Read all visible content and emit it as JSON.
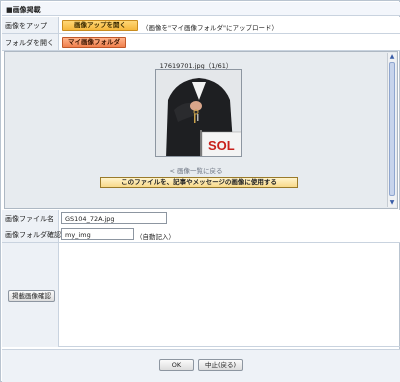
{
  "section_title": "■画像掲載",
  "upload": {
    "label": "画像をアップ",
    "button": "画像アップを開く",
    "hint": "（画像を\"マイ画像フォルダ\"にアップロード）"
  },
  "folder": {
    "label": "フォルダを開く",
    "button": "マイ画像フォルダ"
  },
  "viewer": {
    "filename": "17619701.jpg（1/61）",
    "back_link": "< 画像一覧に戻る",
    "use_button": "このファイルを、記事やメッセージの画像に使用する",
    "photo_text": "SOL"
  },
  "file_name": {
    "label": "画像ファイル名",
    "value": "GS104_72A.jpg"
  },
  "folder_path": {
    "label": "画像フォルダ確認",
    "value": "my_img",
    "note": "（自動記入）"
  },
  "confirm_button": "掲載画像確認",
  "footer": {
    "ok": "OK",
    "cancel": "中止(戻る)"
  },
  "colors": {
    "upload_button": "#f5b73c",
    "folder_button": "#f0804d",
    "label_bg": "#edf1f6",
    "viewer_bg": "#e7ebef"
  }
}
